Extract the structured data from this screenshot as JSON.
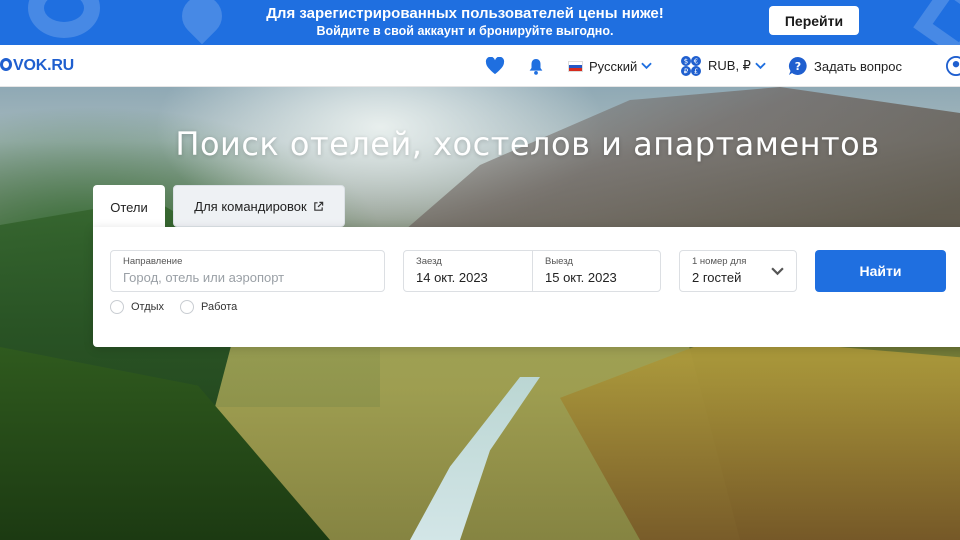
{
  "promo": {
    "line1": "Для зарегистрированных пользователей цены ниже!",
    "line2": "Войдите в свой аккаунт и бронируйте выгодно.",
    "button": "Перейти"
  },
  "header": {
    "logo": "VOK.RU",
    "language": "Русский",
    "currency": "RUB, ₽",
    "ask": "Задать вопрос",
    "icons": [
      "heart-icon",
      "bell-icon",
      "flag-icon",
      "currency-icon",
      "help-icon",
      "user-icon"
    ]
  },
  "hero": {
    "title": "Поиск отелей, хостелов и апартаментов"
  },
  "tabs": {
    "hotels": "Отели",
    "business": "Для командировок"
  },
  "search": {
    "destination_label": "Направление",
    "destination_placeholder": "Город, отель или аэропорт",
    "checkin_label": "Заезд",
    "checkin_value": "14 окт. 2023",
    "checkout_label": "Выезд",
    "checkout_value": "15 окт. 2023",
    "guests_label": "1 номер для",
    "guests_value": "2 гостей",
    "find_button": "Найти",
    "trip_rest": "Отдых",
    "trip_work": "Работа"
  },
  "colors": {
    "brand": "#1f6fe0",
    "logo": "#1f5fcf"
  }
}
